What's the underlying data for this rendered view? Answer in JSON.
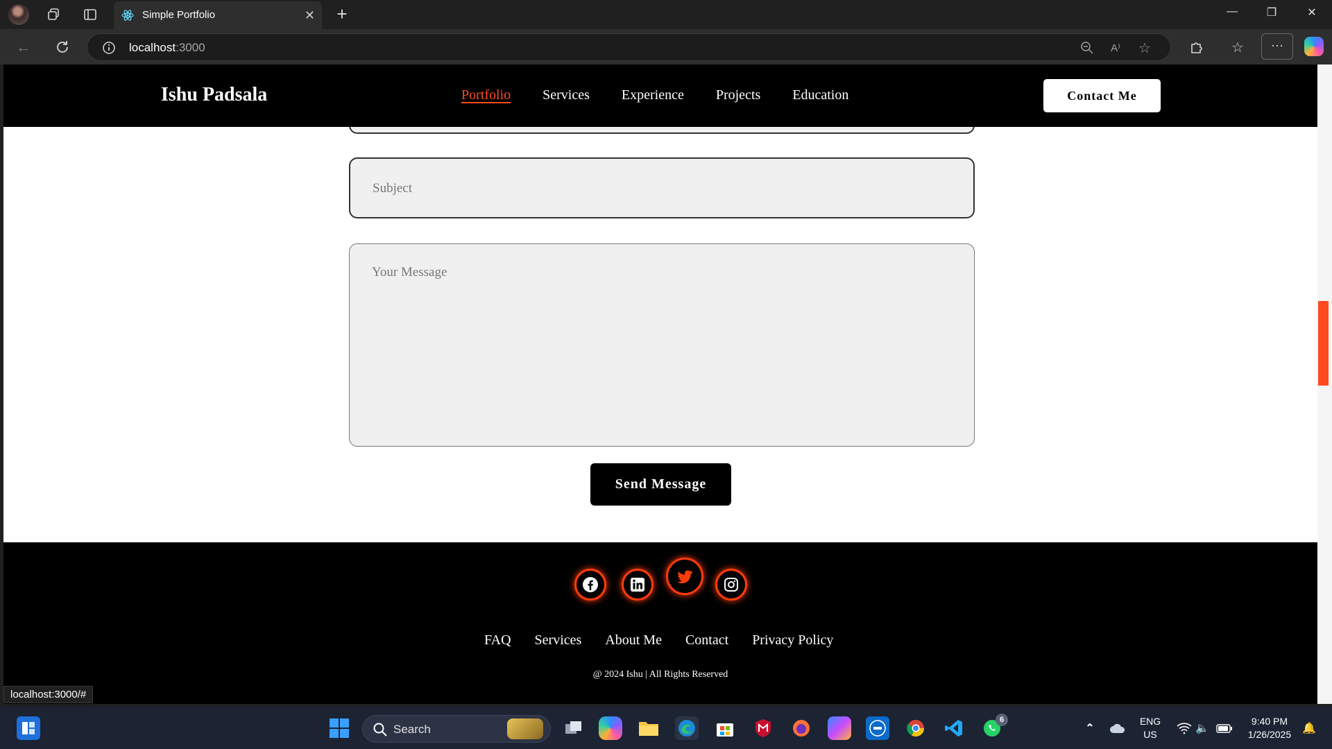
{
  "browser": {
    "tab_title": "Simple Portfolio",
    "address_host": "localhost",
    "address_port": ":3000",
    "status_url": "localhost:3000/#",
    "menu_label": "···"
  },
  "site": {
    "logo": "Ishu Padsala",
    "nav": [
      "Portfolio",
      "Services",
      "Experience",
      "Projects",
      "Education"
    ],
    "active_nav": "Portfolio",
    "contact_button": "Contact Me"
  },
  "form": {
    "subject_placeholder": "Subject",
    "message_placeholder": "Your Message",
    "send_button": "Send Message"
  },
  "footer": {
    "social": [
      "facebook-icon",
      "linkedin-icon",
      "twitter-icon",
      "instagram-icon"
    ],
    "links": [
      "FAQ",
      "Services",
      "About Me",
      "Contact",
      "Privacy Policy"
    ],
    "copyright": "@ 2024 Ishu | All Rights Reserved"
  },
  "taskbar": {
    "search_label": "Search",
    "lang_line1": "ENG",
    "lang_line2": "US",
    "time": "9:40 PM",
    "date": "1/26/2025",
    "whatsapp_badge": "6"
  },
  "colors": {
    "accent": "#ff4b1f",
    "header_bg": "#000000",
    "field_bg": "#f0f0f0"
  }
}
